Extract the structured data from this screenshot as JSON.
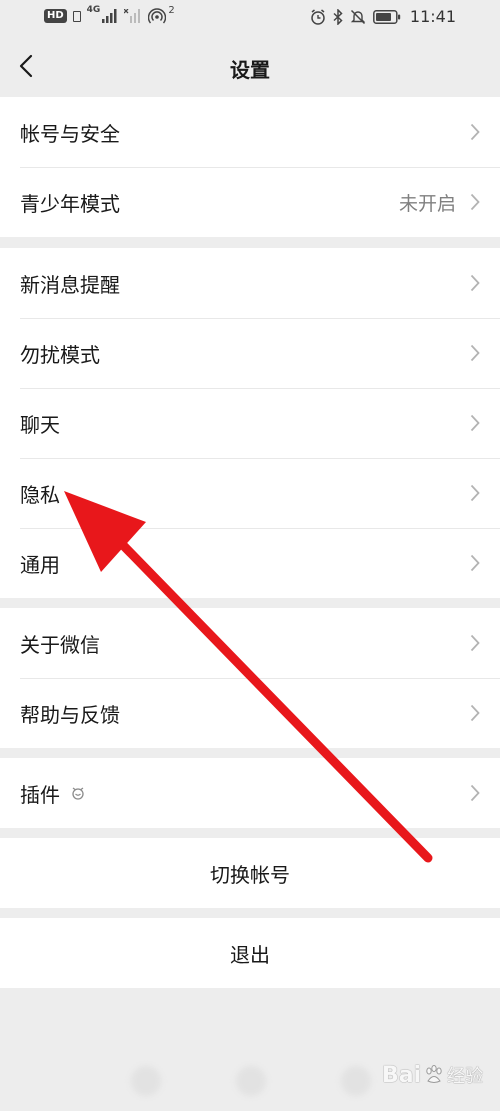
{
  "status_bar": {
    "hd_badge": "HD",
    "network": "4G",
    "hotspot_count": "2",
    "time": "11:41",
    "icons": [
      "sim-icon",
      "signal-icon",
      "signal-no-sim-icon",
      "hotspot-icon",
      "alarm-icon",
      "bluetooth-icon",
      "mute-icon",
      "battery-icon"
    ]
  },
  "header": {
    "back_icon": "chevron-left-icon",
    "title": "设置"
  },
  "groups": [
    {
      "items": [
        {
          "label": "帐号与安全"
        },
        {
          "label": "青少年模式",
          "value": "未开启"
        }
      ]
    },
    {
      "items": [
        {
          "label": "新消息提醒"
        },
        {
          "label": "勿扰模式"
        },
        {
          "label": "聊天"
        },
        {
          "label": "隐私"
        },
        {
          "label": "通用"
        }
      ]
    },
    {
      "items": [
        {
          "label": "关于微信"
        },
        {
          "label": "帮助与反馈"
        }
      ]
    },
    {
      "items": [
        {
          "label": "插件",
          "icon": "plugin-badge-icon"
        }
      ]
    }
  ],
  "actions": {
    "switch_account": "切换帐号",
    "logout": "退出"
  },
  "annotation": {
    "type": "red-arrow",
    "points_to": "隐私",
    "color": "#e8171b"
  },
  "watermark": {
    "text_left": "Bai",
    "text_right": "经验"
  },
  "colors": {
    "background": "#ededed",
    "row_background": "#ffffff",
    "secondary_text": "#808080",
    "chevron": "#b3b3b3"
  }
}
